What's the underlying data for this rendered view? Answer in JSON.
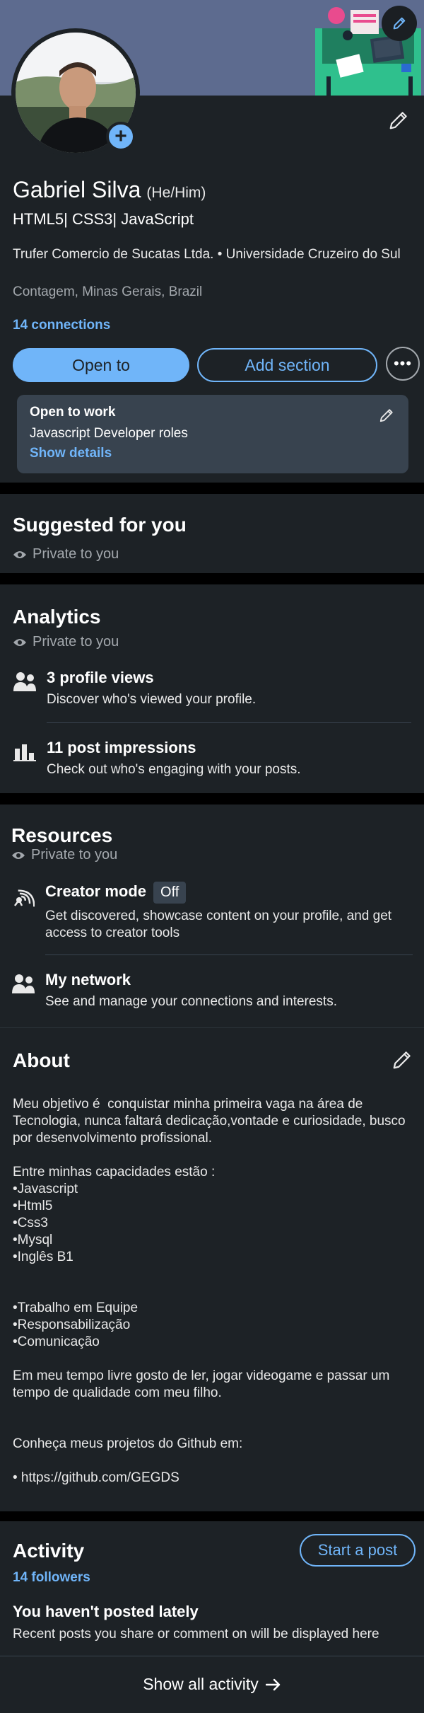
{
  "profile": {
    "name": "Gabriel Silva",
    "pronouns": "(He/Him)",
    "headline": "HTML5| CSS3| JavaScript",
    "education": "Trufer Comercio de Sucatas Ltda. • Universidade Cruzeiro do Sul",
    "location": "Contagem, Minas Gerais, Brazil",
    "connections": "14 connections",
    "open_to_label": "Open to",
    "add_section_label": "Add section",
    "more_icon": "more-horizontal-icon",
    "open_to_work": {
      "title": "Open to work",
      "roles": "Javascript Developer roles",
      "details_label": "Show details"
    }
  },
  "suggested": {
    "title": "Suggested for you",
    "private": "Private to you"
  },
  "analytics": {
    "title": "Analytics",
    "private": "Private to you",
    "items": [
      {
        "title": "3 profile views",
        "subtitle": "Discover who's viewed your profile.",
        "icon": "people-icon"
      },
      {
        "title": "11 post impressions",
        "subtitle": "Check out who's engaging with your posts.",
        "icon": "bar-chart-icon"
      }
    ]
  },
  "resources": {
    "title": "Resources",
    "private": "Private to you",
    "items": [
      {
        "title": "Creator mode",
        "badge": "Off",
        "subtitle": "Get discovered, showcase content on your profile, and get access to creator tools",
        "icon": "broadcast-icon"
      },
      {
        "title": "My network",
        "subtitle": "See and manage your connections and interests.",
        "icon": "people-icon"
      }
    ]
  },
  "about": {
    "title": "About",
    "text": "Meu objetivo é  conquistar minha primeira vaga na área de Tecnologia, nunca faltará dedicação,vontade e curiosidade, busco por desenvolvimento profissional.\n\nEntre minhas capacidades estão :\n•Javascript\n•Html5\n•Css3\n•Mysql\n•Inglês B1\n\n\n•Trabalho em Equipe\n•Responsabilização\n•Comunicação\n\nEm meu tempo livre gosto de ler, jogar videogame e passar um tempo de qualidade com meu filho.\n\n\nConheça meus projetos do Github em:\n\n• https://github.com/GEGDS"
  },
  "activity": {
    "title": "Activity",
    "followers": "14 followers",
    "start_post_label": "Start a post",
    "empty_title": "You haven't posted lately",
    "empty_subtitle": "Recent posts you share or comment on will be displayed here",
    "show_all_label": "Show all activity",
    "show_all_icon": "arrow-right-icon"
  },
  "colors": {
    "background": "#1d2226",
    "accent": "#70b5f9",
    "banner": "#5d6b8f",
    "muted": "#a3a8ad"
  }
}
